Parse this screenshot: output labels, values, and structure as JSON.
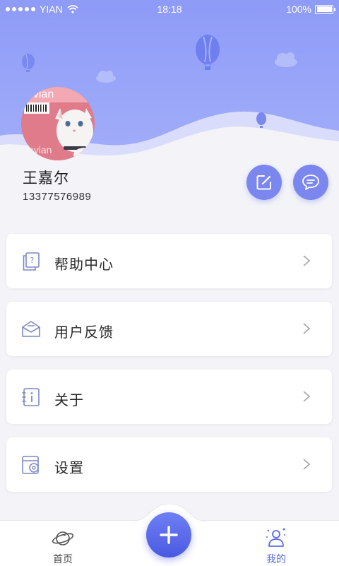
{
  "status_bar": {
    "carrier": "YIAN",
    "time": "18:18",
    "battery": "100%"
  },
  "profile": {
    "name": "王嘉尔",
    "phone": "13377576989"
  },
  "menu": [
    {
      "label": "帮助中心",
      "icon": "help-doc-icon"
    },
    {
      "label": "用户反馈",
      "icon": "feedback-mail-icon"
    },
    {
      "label": "关于",
      "icon": "info-icon"
    },
    {
      "label": "设置",
      "icon": "settings-icon"
    }
  ],
  "tab_bar": {
    "home_label": "首页",
    "mine_label": "我的",
    "active": "mine"
  },
  "colors": {
    "accent": "#6e7ef0",
    "header": "#8c9af7",
    "background": "#f4f4f8"
  }
}
